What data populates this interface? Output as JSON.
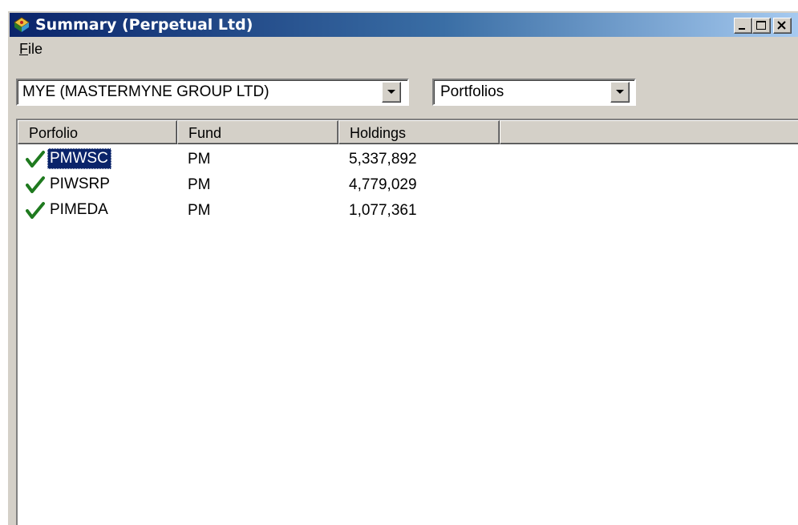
{
  "window": {
    "title": "Summary (Perpetual Ltd)",
    "icon": "app-icon",
    "controls": {
      "minimize_icon": "minimize-icon",
      "maximize_icon": "maximize-icon",
      "close_icon": "close-icon"
    }
  },
  "menu": {
    "file_mnemonic": "F",
    "file_rest": "ile"
  },
  "toolbar": {
    "company_select": "MYE (MASTERMYNE GROUP LTD)",
    "view_select": "Portfolios"
  },
  "table": {
    "columns": [
      "Porfolio",
      "Fund",
      "Holdings"
    ],
    "rows": [
      {
        "portfolio": "PMWSC",
        "fund": "PM",
        "holdings": "5,337,892",
        "status_icon": "check-icon",
        "selected": true
      },
      {
        "portfolio": "PIWSRP",
        "fund": "PM",
        "holdings": "4,779,029",
        "status_icon": "check-icon",
        "selected": false
      },
      {
        "portfolio": "PIMEDA",
        "fund": "PM",
        "holdings": "1,077,361",
        "status_icon": "check-icon",
        "selected": false
      }
    ]
  },
  "colors": {
    "title_active_start": "#0a246a",
    "title_active_end": "#a6caf0",
    "face": "#d4d0c8",
    "selection": "#0a246a",
    "check": "#1f7a1f"
  }
}
